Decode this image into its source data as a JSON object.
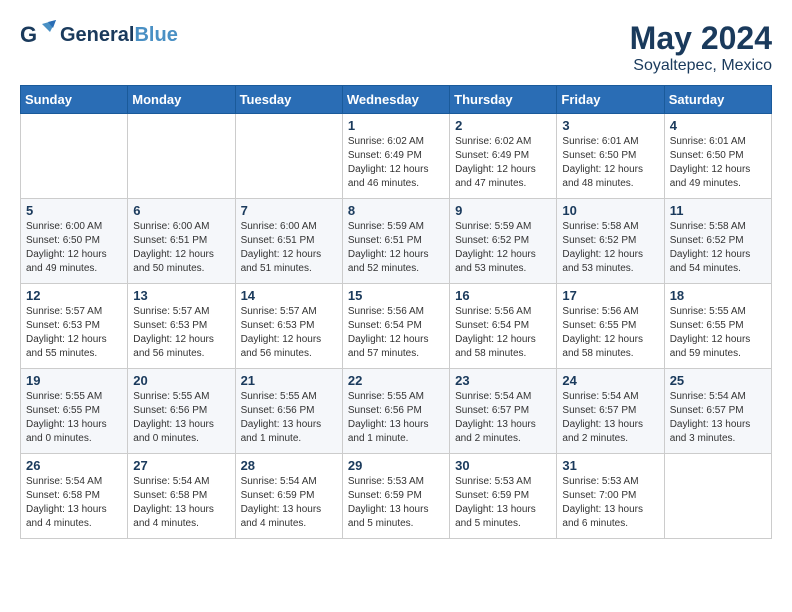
{
  "header": {
    "logo_general": "General",
    "logo_blue": "Blue",
    "month_year": "May 2024",
    "location": "Soyaltepec, Mexico"
  },
  "days_of_week": [
    "Sunday",
    "Monday",
    "Tuesday",
    "Wednesday",
    "Thursday",
    "Friday",
    "Saturday"
  ],
  "weeks": [
    [
      {
        "day": "",
        "info": ""
      },
      {
        "day": "",
        "info": ""
      },
      {
        "day": "",
        "info": ""
      },
      {
        "day": "1",
        "info": "Sunrise: 6:02 AM\nSunset: 6:49 PM\nDaylight: 12 hours\nand 46 minutes."
      },
      {
        "day": "2",
        "info": "Sunrise: 6:02 AM\nSunset: 6:49 PM\nDaylight: 12 hours\nand 47 minutes."
      },
      {
        "day": "3",
        "info": "Sunrise: 6:01 AM\nSunset: 6:50 PM\nDaylight: 12 hours\nand 48 minutes."
      },
      {
        "day": "4",
        "info": "Sunrise: 6:01 AM\nSunset: 6:50 PM\nDaylight: 12 hours\nand 49 minutes."
      }
    ],
    [
      {
        "day": "5",
        "info": "Sunrise: 6:00 AM\nSunset: 6:50 PM\nDaylight: 12 hours\nand 49 minutes."
      },
      {
        "day": "6",
        "info": "Sunrise: 6:00 AM\nSunset: 6:51 PM\nDaylight: 12 hours\nand 50 minutes."
      },
      {
        "day": "7",
        "info": "Sunrise: 6:00 AM\nSunset: 6:51 PM\nDaylight: 12 hours\nand 51 minutes."
      },
      {
        "day": "8",
        "info": "Sunrise: 5:59 AM\nSunset: 6:51 PM\nDaylight: 12 hours\nand 52 minutes."
      },
      {
        "day": "9",
        "info": "Sunrise: 5:59 AM\nSunset: 6:52 PM\nDaylight: 12 hours\nand 53 minutes."
      },
      {
        "day": "10",
        "info": "Sunrise: 5:58 AM\nSunset: 6:52 PM\nDaylight: 12 hours\nand 53 minutes."
      },
      {
        "day": "11",
        "info": "Sunrise: 5:58 AM\nSunset: 6:52 PM\nDaylight: 12 hours\nand 54 minutes."
      }
    ],
    [
      {
        "day": "12",
        "info": "Sunrise: 5:57 AM\nSunset: 6:53 PM\nDaylight: 12 hours\nand 55 minutes."
      },
      {
        "day": "13",
        "info": "Sunrise: 5:57 AM\nSunset: 6:53 PM\nDaylight: 12 hours\nand 56 minutes."
      },
      {
        "day": "14",
        "info": "Sunrise: 5:57 AM\nSunset: 6:53 PM\nDaylight: 12 hours\nand 56 minutes."
      },
      {
        "day": "15",
        "info": "Sunrise: 5:56 AM\nSunset: 6:54 PM\nDaylight: 12 hours\nand 57 minutes."
      },
      {
        "day": "16",
        "info": "Sunrise: 5:56 AM\nSunset: 6:54 PM\nDaylight: 12 hours\nand 58 minutes."
      },
      {
        "day": "17",
        "info": "Sunrise: 5:56 AM\nSunset: 6:55 PM\nDaylight: 12 hours\nand 58 minutes."
      },
      {
        "day": "18",
        "info": "Sunrise: 5:55 AM\nSunset: 6:55 PM\nDaylight: 12 hours\nand 59 minutes."
      }
    ],
    [
      {
        "day": "19",
        "info": "Sunrise: 5:55 AM\nSunset: 6:55 PM\nDaylight: 13 hours\nand 0 minutes."
      },
      {
        "day": "20",
        "info": "Sunrise: 5:55 AM\nSunset: 6:56 PM\nDaylight: 13 hours\nand 0 minutes."
      },
      {
        "day": "21",
        "info": "Sunrise: 5:55 AM\nSunset: 6:56 PM\nDaylight: 13 hours\nand 1 minute."
      },
      {
        "day": "22",
        "info": "Sunrise: 5:55 AM\nSunset: 6:56 PM\nDaylight: 13 hours\nand 1 minute."
      },
      {
        "day": "23",
        "info": "Sunrise: 5:54 AM\nSunset: 6:57 PM\nDaylight: 13 hours\nand 2 minutes."
      },
      {
        "day": "24",
        "info": "Sunrise: 5:54 AM\nSunset: 6:57 PM\nDaylight: 13 hours\nand 2 minutes."
      },
      {
        "day": "25",
        "info": "Sunrise: 5:54 AM\nSunset: 6:57 PM\nDaylight: 13 hours\nand 3 minutes."
      }
    ],
    [
      {
        "day": "26",
        "info": "Sunrise: 5:54 AM\nSunset: 6:58 PM\nDaylight: 13 hours\nand 4 minutes."
      },
      {
        "day": "27",
        "info": "Sunrise: 5:54 AM\nSunset: 6:58 PM\nDaylight: 13 hours\nand 4 minutes."
      },
      {
        "day": "28",
        "info": "Sunrise: 5:54 AM\nSunset: 6:59 PM\nDaylight: 13 hours\nand 4 minutes."
      },
      {
        "day": "29",
        "info": "Sunrise: 5:53 AM\nSunset: 6:59 PM\nDaylight: 13 hours\nand 5 minutes."
      },
      {
        "day": "30",
        "info": "Sunrise: 5:53 AM\nSunset: 6:59 PM\nDaylight: 13 hours\nand 5 minutes."
      },
      {
        "day": "31",
        "info": "Sunrise: 5:53 AM\nSunset: 7:00 PM\nDaylight: 13 hours\nand 6 minutes."
      },
      {
        "day": "",
        "info": ""
      }
    ]
  ]
}
